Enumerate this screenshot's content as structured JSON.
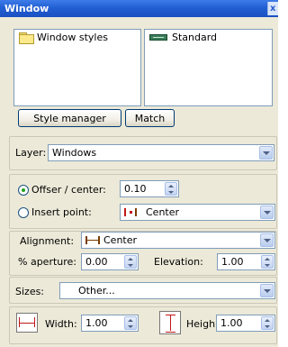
{
  "window": {
    "title": "Window",
    "close_glyph": "x"
  },
  "styles": {
    "left_items": [
      {
        "label": "Window styles",
        "icon": "folder-icon"
      }
    ],
    "right_items": [
      {
        "label": "Standard",
        "icon": "window-standard-icon"
      }
    ]
  },
  "buttons": {
    "style_manager": "Style manager",
    "match": "Match"
  },
  "layer": {
    "label": "Layer:",
    "value": "Windows"
  },
  "placement": {
    "offset_label": "Offser / center:",
    "offset_value": "0.10",
    "offset_selected": true,
    "insert_label": "Insert point:",
    "insert_value": "Center",
    "insert_selected": false
  },
  "alignment": {
    "label": "Alignment:",
    "value": "Center",
    "aperture_label": "% aperture:",
    "aperture_value": "0.00",
    "elevation_label": "Elevation:",
    "elevation_value": "1.00"
  },
  "sizes": {
    "label": "Sizes:",
    "value": "Other..."
  },
  "dimensions": {
    "width_label": "Width:",
    "width_value": "1.00",
    "height_label": "Heigh",
    "height_value": "1.00"
  },
  "colors": {
    "titlebar": "#2260d4",
    "panel": "#ece9d8",
    "border": "#7f9db9"
  }
}
